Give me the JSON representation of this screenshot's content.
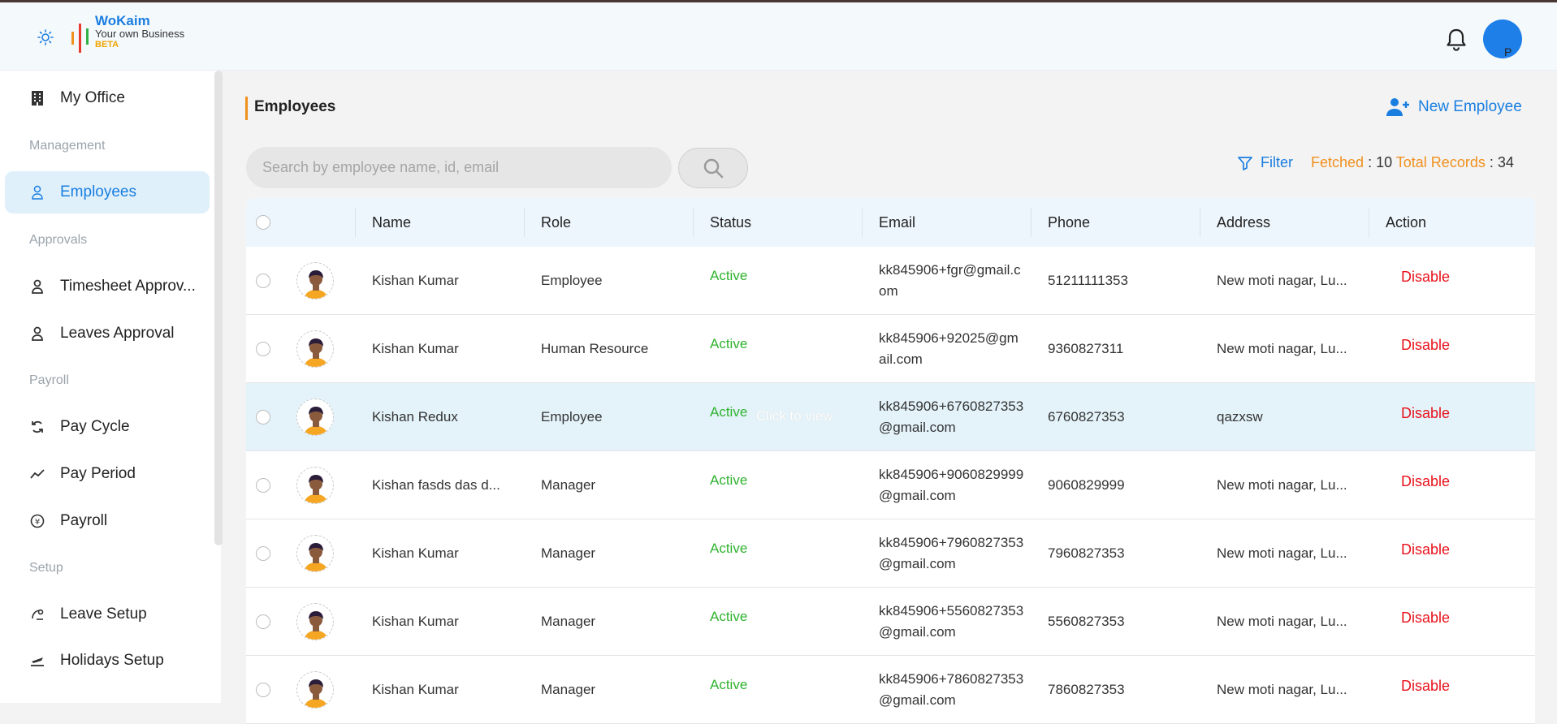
{
  "brand": {
    "name": "WoKaim",
    "tagline": "Your own Business",
    "beta": "BETA"
  },
  "header": {
    "avatar_initial": "P"
  },
  "sidebar": {
    "items": [
      {
        "label": "My Office",
        "icon": "building-icon"
      },
      {
        "label": "Employees",
        "icon": "person-icon",
        "active": true
      },
      {
        "label": "Timesheet Approv...",
        "icon": "user-check-icon"
      },
      {
        "label": "Leaves Approval",
        "icon": "user-check-icon"
      },
      {
        "label": "Pay Cycle",
        "icon": "cycle-icon"
      },
      {
        "label": "Pay Period",
        "icon": "trend-icon"
      },
      {
        "label": "Payroll",
        "icon": "currency-icon"
      },
      {
        "label": "Leave Setup",
        "icon": "leave-icon"
      },
      {
        "label": "Holidays Setup",
        "icon": "plane-icon"
      }
    ],
    "sections": [
      "Management",
      "Approvals",
      "Payroll",
      "Setup"
    ]
  },
  "page": {
    "title": "Employees",
    "new_button": "New Employee"
  },
  "search": {
    "placeholder": "Search by employee name, id, email"
  },
  "filter": {
    "label": "Filter",
    "fetched_label": "Fetched",
    "fetched_value": ": 10",
    "total_label": "Total Records",
    "total_value": ": 34"
  },
  "table": {
    "columns": [
      "Name",
      "Role",
      "Status",
      "Email",
      "Phone",
      "Address",
      "Action"
    ],
    "click_hint": "Click to view",
    "rows": [
      {
        "name": "Kishan Kumar",
        "role": "Employee",
        "status": "Active",
        "email": "kk845906+fgr@gmail.com",
        "phone": "51211111353",
        "address": "New moti nagar, Lu...",
        "action": "Disable"
      },
      {
        "name": "Kishan Kumar",
        "role": "Human Resource",
        "status": "Active",
        "email": "kk845906+92025@gmail.com",
        "phone": "9360827311",
        "address": "New moti nagar, Lu...",
        "action": "Disable"
      },
      {
        "name": "Kishan Redux",
        "role": "Employee",
        "status": "Active",
        "email": "kk845906+6760827353@gmail.com",
        "phone": "6760827353",
        "address": "qazxsw",
        "action": "Disable"
      },
      {
        "name": "Kishan fasds das d...",
        "role": "Manager",
        "status": "Active",
        "email": "kk845906+9060829999@gmail.com",
        "phone": "9060829999",
        "address": "New moti nagar, Lu...",
        "action": "Disable"
      },
      {
        "name": "Kishan Kumar",
        "role": "Manager",
        "status": "Active",
        "email": "kk845906+7960827353@gmail.com",
        "phone": "7960827353",
        "address": "New moti nagar, Lu...",
        "action": "Disable"
      },
      {
        "name": "Kishan Kumar",
        "role": "Manager",
        "status": "Active",
        "email": "kk845906+5560827353@gmail.com",
        "phone": "5560827353",
        "address": "New moti nagar, Lu...",
        "action": "Disable"
      },
      {
        "name": "Kishan Kumar",
        "role": "Manager",
        "status": "Active",
        "email": "kk845906+7860827353@gmail.com",
        "phone": "7860827353",
        "address": "New moti nagar, Lu...",
        "action": "Disable"
      }
    ]
  },
  "colors": {
    "accent": "#1a7ee0",
    "orange": "#f0901e",
    "active": "#2fb32f",
    "danger": "#e8121b",
    "highlight_row": "#e4f3fa"
  }
}
